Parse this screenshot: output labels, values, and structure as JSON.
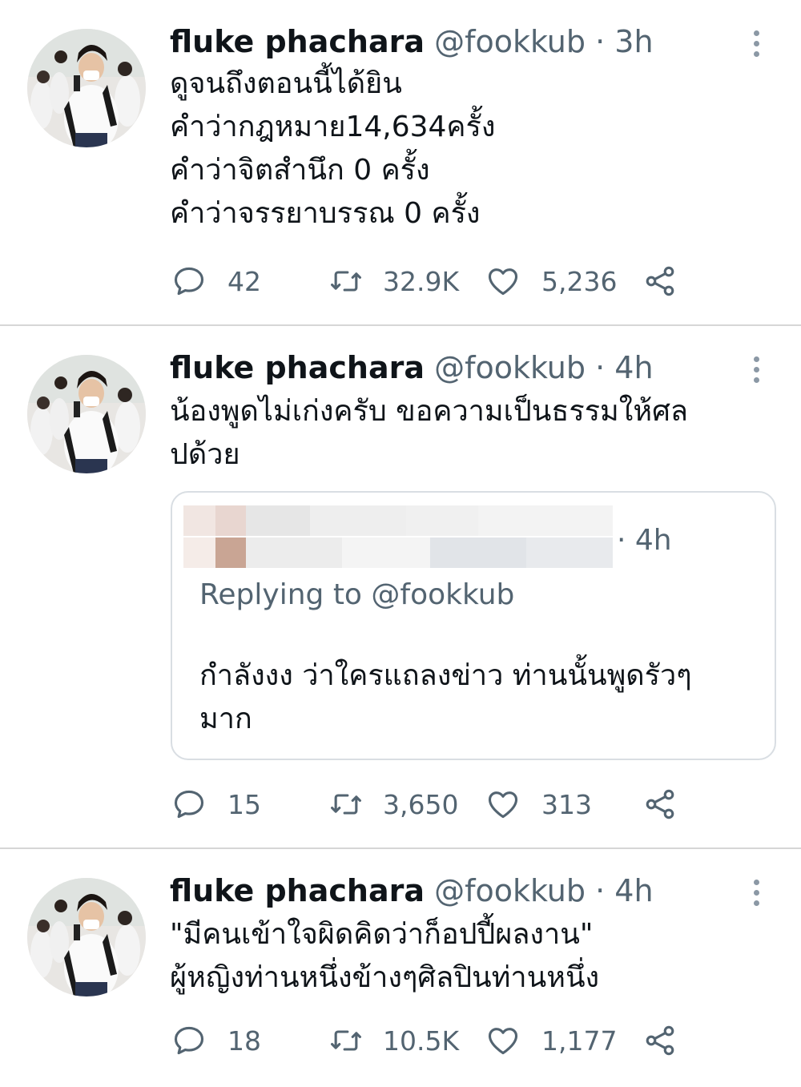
{
  "colors": {
    "text": "#0f1419",
    "muted": "#536471",
    "divider": "#d6d6d6",
    "border": "#d9dee3"
  },
  "tweets": [
    {
      "name": "fluke phachara",
      "handle": "@fookkub",
      "time": "· 3h",
      "lines": [
        "ดูจนถึงตอนนี้ได้ยิน",
        "คำว่ากฎหมาย14,634ครั้ง",
        "คำว่าจิตสำนึก 0 ครั้ง",
        "คำว่าจรรยาบรรณ 0 ครั้ง"
      ],
      "replies": "42",
      "retweets": "32.9K",
      "likes": "5,236"
    },
    {
      "name": "fluke phachara",
      "handle": "@fookkub",
      "time": "· 4h",
      "lines": [
        "น้องพูดไม่เก่งครับ ขอความเป็นธรรมให้ศล",
        "ปด้วย"
      ],
      "quote": {
        "time": "· 4h",
        "replying_to": "Replying to @fookkub",
        "lines": [
          "กำลังงง ว่าใครแถลงข่าว ท่านนั้นพูดรัวๆ",
          "มาก"
        ]
      },
      "replies": "15",
      "retweets": "3,650",
      "likes": "313"
    },
    {
      "name": "fluke phachara",
      "handle": "@fookkub",
      "time": "· 4h",
      "lines": [
        "\"มีคนเข้าใจผิดคิดว่าก็อปปี้ผลงาน\"",
        "ผู้หญิงท่านหนึ่งข้างๆศิลปินท่านหนึ่ง"
      ],
      "replies": "18",
      "retweets": "10.5K",
      "likes": "1,177"
    }
  ],
  "icons": {
    "reply": "reply-icon",
    "retweet": "retweet-icon",
    "like": "heart-icon",
    "share": "share-icon",
    "more": "more-vertical-icon"
  }
}
